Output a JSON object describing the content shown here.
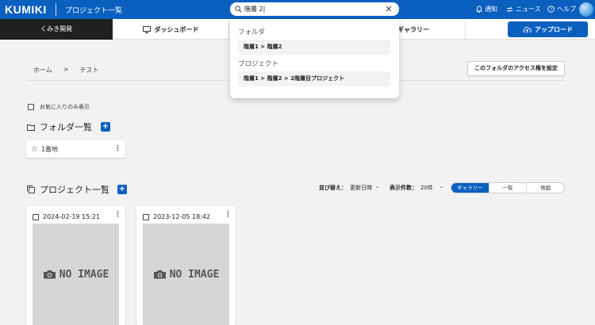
{
  "header": {
    "logo": "KUMIKI",
    "title": "プロジェクト一覧",
    "search_value": "階層 2|",
    "links": {
      "notify": "通知",
      "news": "ニュース",
      "help": "ヘルプ"
    }
  },
  "nav": {
    "kumi": "くみき開発",
    "dashboard": "ダッシュボード",
    "gallery": "ギャラリー",
    "upload": "アップロード"
  },
  "breadcrumb": {
    "home": "ホーム",
    "sep": ">",
    "current": "テスト"
  },
  "access_button": "このフォルダのアクセス権を設定",
  "favorites_only": "お気に入りのみ表示",
  "folders": {
    "title": "フォルダ一覧",
    "items": [
      {
        "name": "1番地"
      }
    ]
  },
  "projects": {
    "title": "プロジェクト一覧",
    "sort_label": "並び替え：",
    "sort_value": "更新日時",
    "count_label": "表示件数：",
    "count_value": "20件",
    "views": [
      "ギャラリー",
      "一覧",
      "地図"
    ],
    "items": [
      {
        "date": "2024-02-19 15:21",
        "image": "NO IMAGE"
      },
      {
        "date": "2023-12-05 18:42",
        "image": "NO IMAGE"
      }
    ]
  },
  "dropdown": {
    "folder_heading": "フォルダ",
    "folder_item": "階層1 > 階層2",
    "project_heading": "プロジェクト",
    "project_item": "階層1 > 階層2 > 2階層目プロジェクト"
  }
}
